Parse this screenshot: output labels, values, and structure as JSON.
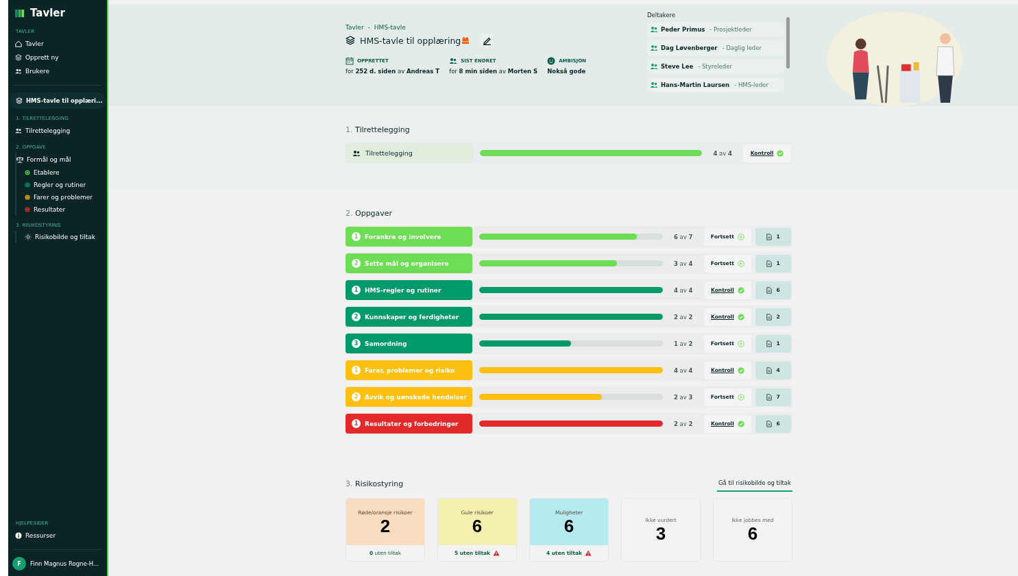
{
  "sidebar": {
    "brand": "Tavler",
    "sections": [
      {
        "heading": "TAVLER",
        "items": [
          {
            "label": "Tavler",
            "kind": "home"
          },
          {
            "label": "Opprett ny",
            "kind": "stack"
          },
          {
            "label": "Brukere",
            "kind": "users"
          }
        ]
      }
    ],
    "board": {
      "label": "HMS-tavle til opplæri..."
    },
    "groups": [
      {
        "heading": "1. TILRETTELEGGING",
        "items": [
          {
            "label": "Tilrettelegging",
            "kind": "users"
          }
        ]
      },
      {
        "heading": "2. OPPGAVE",
        "items": [
          {
            "label": "Formål og mål",
            "kind": "scale"
          },
          {
            "label": "Etablere",
            "kind": "target",
            "color": "#4cc43a"
          },
          {
            "label": "Regler og rutiner",
            "kind": "target",
            "color": "#009162"
          },
          {
            "label": "Farer og problemer",
            "kind": "target",
            "color": "#e8b010"
          },
          {
            "label": "Resultater",
            "kind": "target",
            "color": "#d42a2a"
          }
        ]
      },
      {
        "heading": "3. RISIKOSTYRING",
        "items": [
          {
            "label": "Risikobilde og tiltak",
            "kind": "bulb"
          }
        ]
      }
    ],
    "help": {
      "heading": "HJELPESIDER",
      "item": "Ressurser"
    },
    "user": {
      "initial": "F",
      "name": "Finn Magnus Rogne-H..."
    }
  },
  "header": {
    "breadcrumb": [
      "Tavler",
      "HMS-tavle"
    ],
    "breadcrumb_separator": "-",
    "title": "HMS-tavle til opplæring",
    "meta": [
      {
        "kind": "calendar",
        "label": "OPPRETTET",
        "value": "for **252 d. siden** av **Andreas T**"
      },
      {
        "kind": "users",
        "label": "SIST ENDRET",
        "value": "for **8 min siden** av **Morten S**"
      },
      {
        "kind": "smile",
        "label": "AMBISJON",
        "value": "**Nokså gode**"
      }
    ],
    "participants_title": "Deltakere",
    "participants": [
      {
        "name": "Peder Primus",
        "role": "- Prosjektleder"
      },
      {
        "name": "Dag Løvenberger",
        "role": "- Daglig leder"
      },
      {
        "name": "Steve Lee",
        "role": "- Styreleder"
      },
      {
        "name": "Hans-Martin Laursen",
        "role": "- HMS-leder"
      }
    ]
  },
  "section1": {
    "number": "1.",
    "title": "Tilrettelegging",
    "row": {
      "name": "Tilrettelegging",
      "level": 1,
      "progress": "**4** av **4**",
      "action": "Kontroll",
      "kind": "control"
    }
  },
  "section2": {
    "number": "2.",
    "title": "Oppgaver",
    "rows": [
      {
        "badge": "1",
        "name": "Forankre og involvere",
        "color": "#6fdc55",
        "level": 0.857,
        "progress": "**6** av **7**",
        "action": "Fortsett",
        "kind": "continue",
        "docs": "1"
      },
      {
        "badge": "2",
        "name": "Sette mål og organisere",
        "color": "#6fdc55",
        "level": 0.75,
        "progress": "**3** av **4**",
        "action": "Fortsett",
        "kind": "continue",
        "docs": "1"
      },
      {
        "badge": "1",
        "name": "HMS-regler og rutiner",
        "color": "#00996a",
        "level": 1,
        "progress": "**4** av **4**",
        "action": "Kontroll",
        "kind": "control",
        "docs": "6"
      },
      {
        "badge": "2",
        "name": "Kunnskaper og ferdigheter",
        "color": "#00996a",
        "level": 1,
        "progress": "**2** av **2**",
        "action": "Kontroll",
        "kind": "control",
        "docs": "2"
      },
      {
        "badge": "3",
        "name": "Samordning",
        "color": "#00996a",
        "level": 0.5,
        "progress": "**1** av **2**",
        "action": "Fortsett",
        "kind": "continue",
        "docs": "1"
      },
      {
        "badge": "1",
        "name": "Farer, problemer og risiko",
        "color": "#fbc012",
        "level": 1,
        "progress": "**4** av **4**",
        "action": "Kontroll",
        "kind": "control",
        "docs": "4"
      },
      {
        "badge": "2",
        "name": "Avvik og uønskede hendelser",
        "color": "#fbc012",
        "level": 0.667,
        "progress": "**2** av **3**",
        "action": "Fortsett",
        "kind": "continue",
        "docs": "7"
      },
      {
        "badge": "1",
        "name": "Resultater og forbedringer",
        "color": "#e3292a",
        "level": 1,
        "progress": "**2** av **2**",
        "action": "Kontroll",
        "kind": "control",
        "docs": "6"
      }
    ]
  },
  "section3": {
    "number": "3.",
    "title": "Risikostyring",
    "link": "Gå til risikobilde og tiltak",
    "cards": [
      {
        "label": "Røde/oransje risikoer",
        "value": "2",
        "color": "#f8dcc0",
        "footer": "**0** uten tiltak",
        "warning": false
      },
      {
        "label": "Gule risikoer",
        "value": "6",
        "color": "#f4f0b0",
        "footer": "**5 uten tiltak**",
        "warning": true
      },
      {
        "label": "Muligheter",
        "value": "6",
        "color": "#b4eaf0",
        "footer": "**4 uten tiltak**",
        "warning": true
      },
      {
        "label": "Ikke vurdert",
        "value": "3",
        "color": "#f3f3f3"
      },
      {
        "label": "Ikke jobbes med",
        "value": "6",
        "color": "#f3f3f3"
      }
    ]
  }
}
